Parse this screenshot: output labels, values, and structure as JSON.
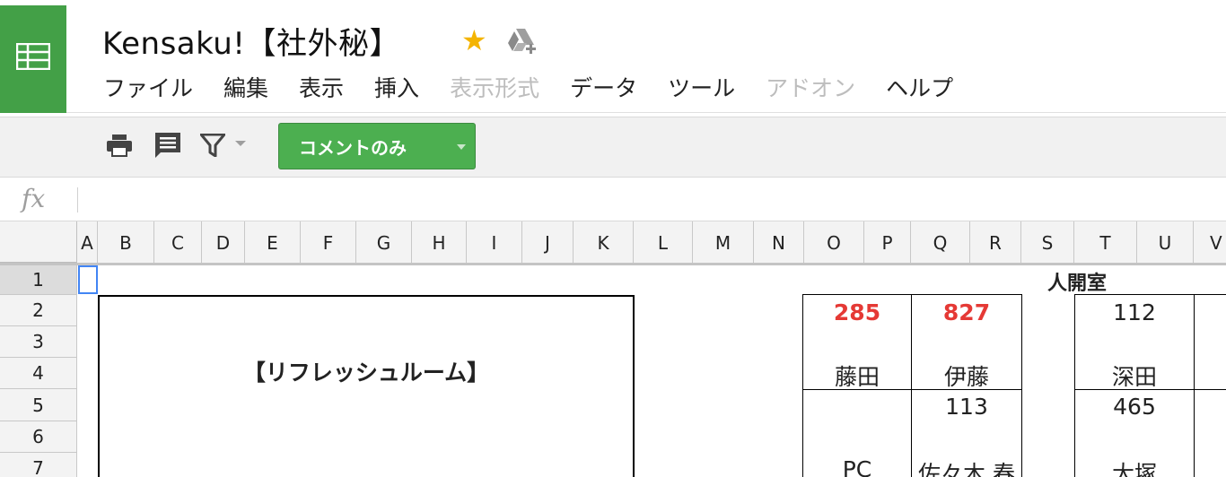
{
  "app": {
    "title": "Kensaku!【社外秘】",
    "icons": {
      "logo": "sheets-grid-icon",
      "star": "star-icon",
      "drive": "drive-add-icon"
    },
    "colors": {
      "brand": "#43a047",
      "star": "#f4b400",
      "accent_red": "#e53935",
      "selection": "#4285f4"
    }
  },
  "menu": [
    {
      "label": "ファイル",
      "enabled": true
    },
    {
      "label": "編集",
      "enabled": true
    },
    {
      "label": "表示",
      "enabled": true
    },
    {
      "label": "挿入",
      "enabled": true
    },
    {
      "label": "表示形式",
      "enabled": false
    },
    {
      "label": "データ",
      "enabled": true
    },
    {
      "label": "ツール",
      "enabled": true
    },
    {
      "label": "アドオン",
      "enabled": false
    },
    {
      "label": "ヘルプ",
      "enabled": true
    }
  ],
  "toolbar": {
    "icons": [
      "print-icon",
      "comment-list-icon",
      "filter-icon"
    ],
    "mode_button": "コメントのみ"
  },
  "formula_bar": {
    "label": "fx",
    "value": ""
  },
  "columns": [
    "A",
    "B",
    "C",
    "D",
    "E",
    "F",
    "G",
    "H",
    "I",
    "J",
    "K",
    "L",
    "M",
    "N",
    "O",
    "P",
    "Q",
    "R",
    "S",
    "T",
    "U",
    "V"
  ],
  "rows": [
    "1",
    "2",
    "3",
    "4",
    "5",
    "6",
    "7"
  ],
  "sheet": {
    "room_label": "人開室",
    "area_label": "【リフレッシュルーム】",
    "desks": [
      {
        "number": "285",
        "name": "藤田",
        "highlight": true
      },
      {
        "number": "827",
        "name": "伊藤",
        "highlight": true
      },
      {
        "number": "112",
        "name": "深田",
        "highlight": false
      },
      {
        "number": "",
        "name": "PC",
        "highlight": false
      },
      {
        "number": "113",
        "name": "佐々木 春",
        "highlight": false
      },
      {
        "number": "465",
        "name": "大塚",
        "highlight": false
      }
    ]
  }
}
